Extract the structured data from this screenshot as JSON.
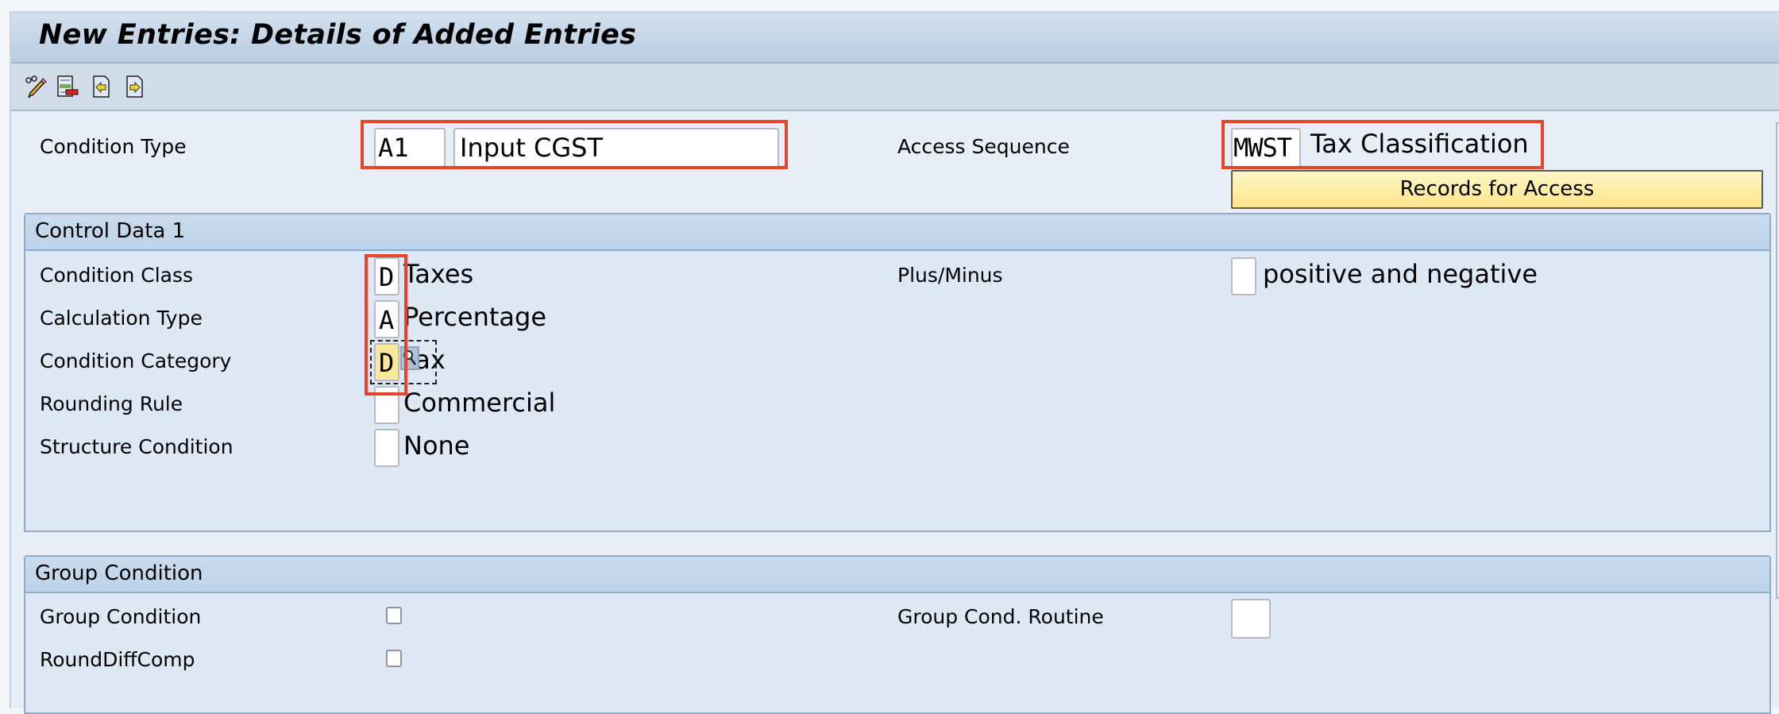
{
  "window": {
    "title": "New Entries: Details of Added Entries"
  },
  "toolbar": {
    "buttons": [
      {
        "icon": "change-display-pencil-icon",
        "label": "Display/Change"
      },
      {
        "icon": "delete-entry-icon",
        "label": "Delete"
      },
      {
        "icon": "previous-entry-icon",
        "label": "Previous Entry"
      },
      {
        "icon": "next-entry-icon",
        "label": "Next Entry"
      }
    ]
  },
  "header": {
    "condition_type": {
      "label": "Condition Type",
      "code": "A1",
      "description": "Input CGST"
    },
    "access_sequence": {
      "label": "Access Sequence",
      "code": "MWST",
      "description": "Tax Classification"
    },
    "records_button": "Records for Access"
  },
  "control_data_1": {
    "title": "Control Data 1",
    "rows": [
      {
        "label": "Condition Class",
        "code": "D",
        "description": "Taxes"
      },
      {
        "label": "Calculation Type",
        "code": "A",
        "description": "Percentage"
      },
      {
        "label": "Condition Category",
        "code": "D",
        "description": "Tax"
      },
      {
        "label": "Rounding Rule",
        "code": "",
        "description": "Commercial"
      },
      {
        "label": "Structure Condition",
        "code": "",
        "description": "None"
      }
    ],
    "plus_minus": {
      "label": "Plus/Minus",
      "code": "",
      "description": "positive and negative"
    }
  },
  "group_condition": {
    "title": "Group Condition",
    "group_condition": {
      "label": "Group Condition",
      "checked": false
    },
    "round_diff_comp": {
      "label": "RoundDiffComp",
      "checked": false
    },
    "group_cond_routine": {
      "label": "Group Cond. Routine",
      "value": ""
    }
  },
  "colors": {
    "highlight_box": "#e8432b",
    "focused_field": "#fbe89a",
    "button_yellow": "#fde58a"
  }
}
